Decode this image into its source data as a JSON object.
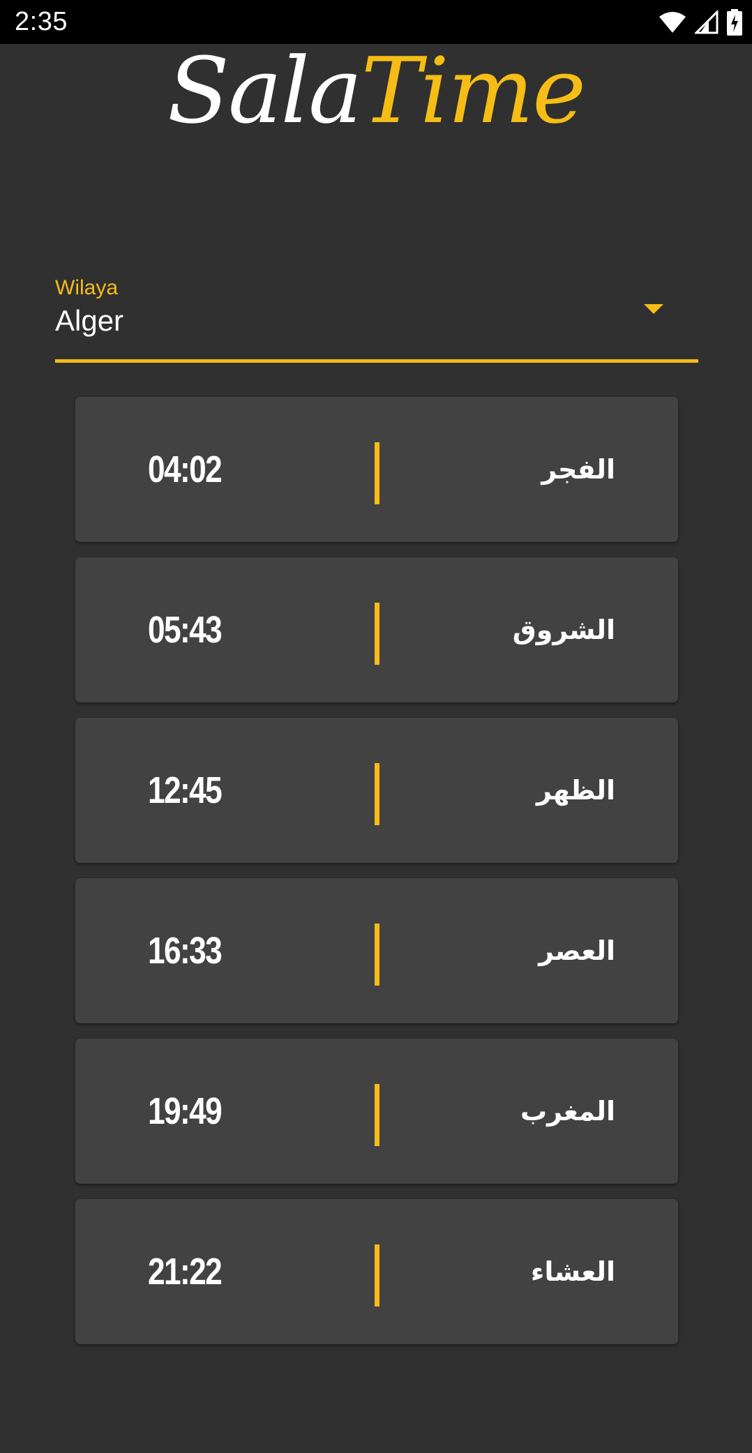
{
  "status_bar": {
    "time": "2:35",
    "icons": [
      "wifi-icon",
      "signal-icon",
      "battery-charging-icon"
    ]
  },
  "logo": {
    "part_a": "Sala",
    "part_b": "Time"
  },
  "wilaya_dropdown": {
    "label": "Wilaya",
    "selected_value": "Alger"
  },
  "prayers": [
    {
      "name": "الفجر",
      "time": "04:02"
    },
    {
      "name": "الشروق",
      "time": "05:43"
    },
    {
      "name": "الظهر",
      "time": "12:45"
    },
    {
      "name": "العصر",
      "time": "16:33"
    },
    {
      "name": "المغرب",
      "time": "19:49"
    },
    {
      "name": "العشاء",
      "time": "21:22"
    }
  ],
  "colors": {
    "background": "#303030",
    "card": "#424242",
    "accent": "#f5bd16",
    "text": "#ffffff",
    "status_bar": "#000000"
  }
}
